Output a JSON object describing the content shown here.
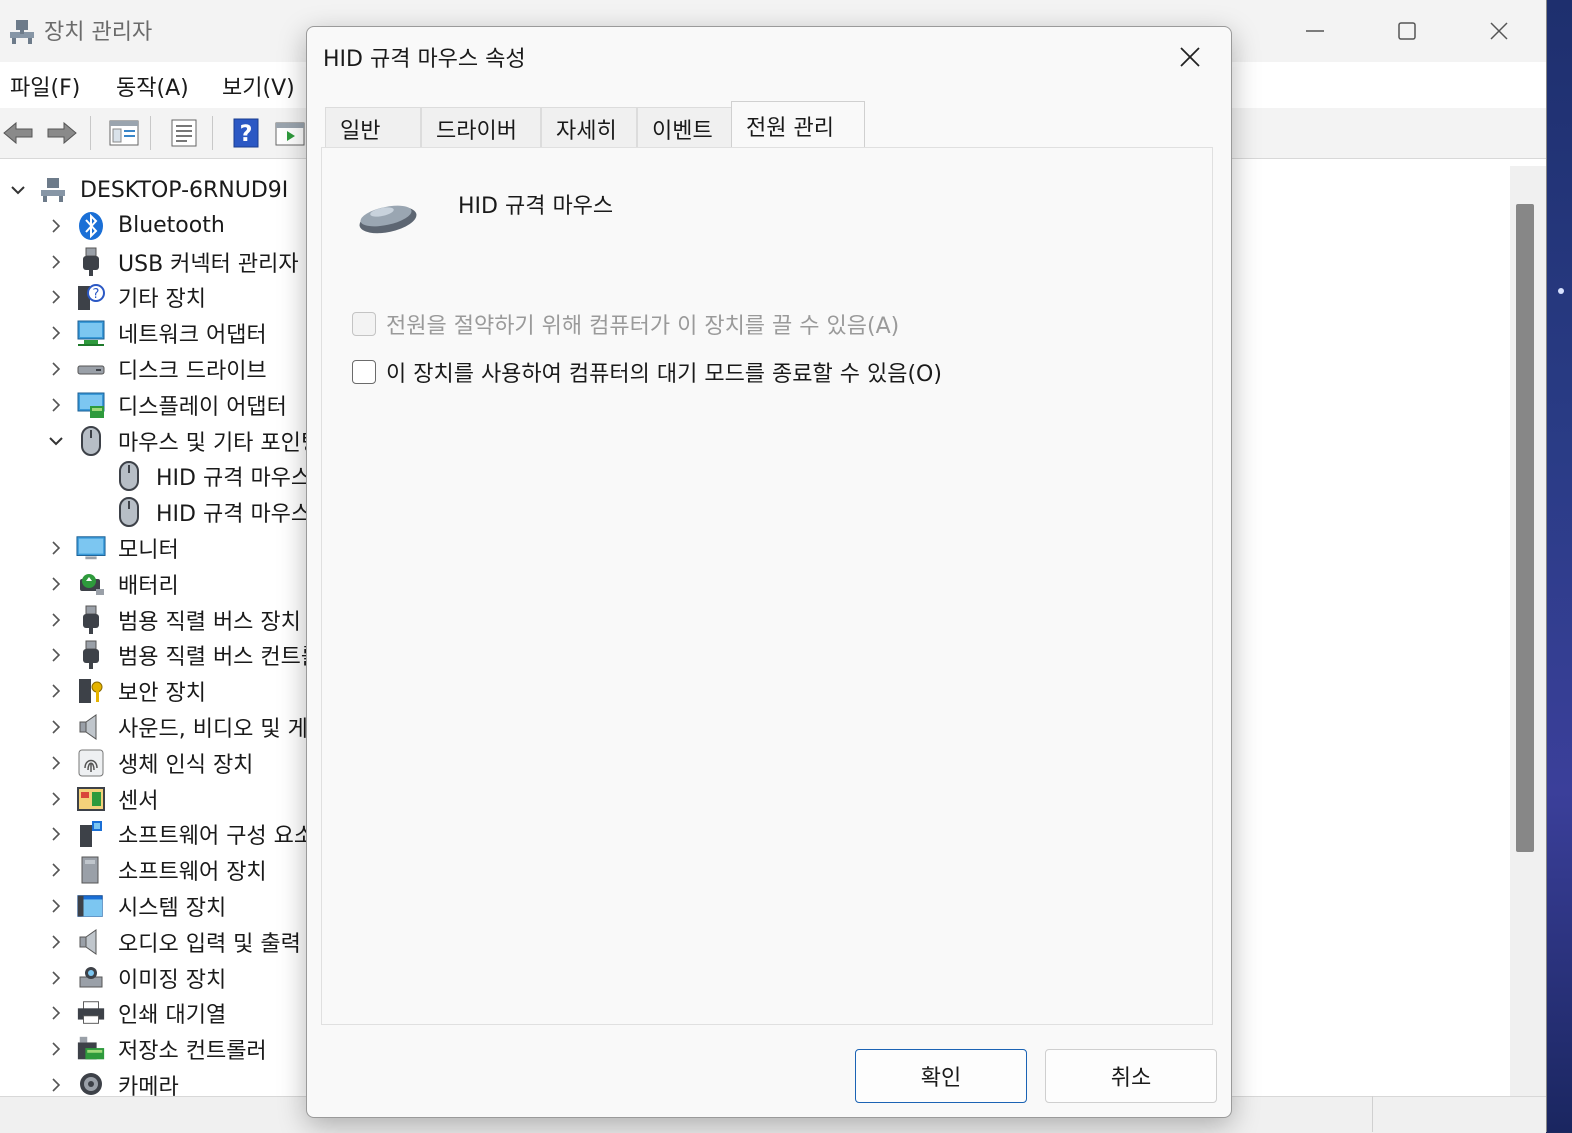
{
  "app": {
    "title": "장치 관리자",
    "menus": [
      "파일(F)",
      "동작(A)",
      "보기(V)"
    ]
  },
  "tree": {
    "root": "DESKTOP-6RNUD9I",
    "items": [
      {
        "label": "Bluetooth",
        "icon": "bluetooth-icon",
        "expanded": false,
        "level": 1
      },
      {
        "label": "USB 커넥터 관리자",
        "icon": "usb-icon",
        "expanded": false,
        "level": 1
      },
      {
        "label": "기타 장치",
        "icon": "unknown-device-icon",
        "expanded": false,
        "level": 1
      },
      {
        "label": "네트워크 어댑터",
        "icon": "network-adapter-icon",
        "expanded": false,
        "level": 1
      },
      {
        "label": "디스크 드라이브",
        "icon": "disk-drive-icon",
        "expanded": false,
        "level": 1
      },
      {
        "label": "디스플레이 어댑터",
        "icon": "display-adapter-icon",
        "expanded": false,
        "level": 1
      },
      {
        "label": "마우스 및 기타 포인팅 장치",
        "icon": "mouse-icon",
        "expanded": true,
        "level": 1
      },
      {
        "label": "HID 규격 마우스",
        "icon": "mouse-icon",
        "level": 2
      },
      {
        "label": "HID 규격 마우스",
        "icon": "mouse-icon",
        "level": 2
      },
      {
        "label": "모니터",
        "icon": "monitor-icon",
        "expanded": false,
        "level": 1
      },
      {
        "label": "배터리",
        "icon": "battery-icon",
        "expanded": false,
        "level": 1
      },
      {
        "label": "범용 직렬 버스 장치",
        "icon": "usb-icon",
        "expanded": false,
        "level": 1
      },
      {
        "label": "범용 직렬 버스 컨트롤러",
        "icon": "usb-icon",
        "expanded": false,
        "level": 1
      },
      {
        "label": "보안 장치",
        "icon": "security-device-icon",
        "expanded": false,
        "level": 1
      },
      {
        "label": "사운드, 비디오 및 게임 컨트롤러",
        "icon": "speaker-icon",
        "expanded": false,
        "level": 1
      },
      {
        "label": "생체 인식 장치",
        "icon": "fingerprint-icon",
        "expanded": false,
        "level": 1
      },
      {
        "label": "센서",
        "icon": "sensor-icon",
        "expanded": false,
        "level": 1
      },
      {
        "label": "소프트웨어 구성 요소",
        "icon": "software-component-icon",
        "expanded": false,
        "level": 1
      },
      {
        "label": "소프트웨어 장치",
        "icon": "software-device-icon",
        "expanded": false,
        "level": 1
      },
      {
        "label": "시스템 장치",
        "icon": "system-device-icon",
        "expanded": false,
        "level": 1
      },
      {
        "label": "오디오 입력 및 출력",
        "icon": "speaker-icon",
        "expanded": false,
        "level": 1
      },
      {
        "label": "이미징 장치",
        "icon": "imaging-device-icon",
        "expanded": false,
        "level": 1
      },
      {
        "label": "인쇄 대기열",
        "icon": "printer-icon",
        "expanded": false,
        "level": 1
      },
      {
        "label": "저장소 컨트롤러",
        "icon": "storage-controller-icon",
        "expanded": false,
        "level": 1
      },
      {
        "label": "카메라",
        "icon": "camera-icon",
        "expanded": false,
        "level": 1
      }
    ]
  },
  "dialog": {
    "title": "HID 규격 마우스 속성",
    "tabs": [
      "일반",
      "드라이버",
      "자세히",
      "이벤트",
      "전원 관리"
    ],
    "active_tab": "전원 관리",
    "device_name": "HID 규격 마우스",
    "options": [
      {
        "label": "전원을 절약하기 위해 컴퓨터가 이 장치를 끌 수 있음(A)",
        "checked": false,
        "enabled": false
      },
      {
        "label": "이 장치를 사용하여 컴퓨터의 대기 모드를 종료할 수 있음(O)",
        "checked": false,
        "enabled": true
      }
    ],
    "ok_label": "확인",
    "cancel_label": "취소"
  },
  "colors": {
    "accent": "#1b63b4",
    "scroll_thumb": "#878787",
    "dialog_bg": "#f9f9f9"
  }
}
